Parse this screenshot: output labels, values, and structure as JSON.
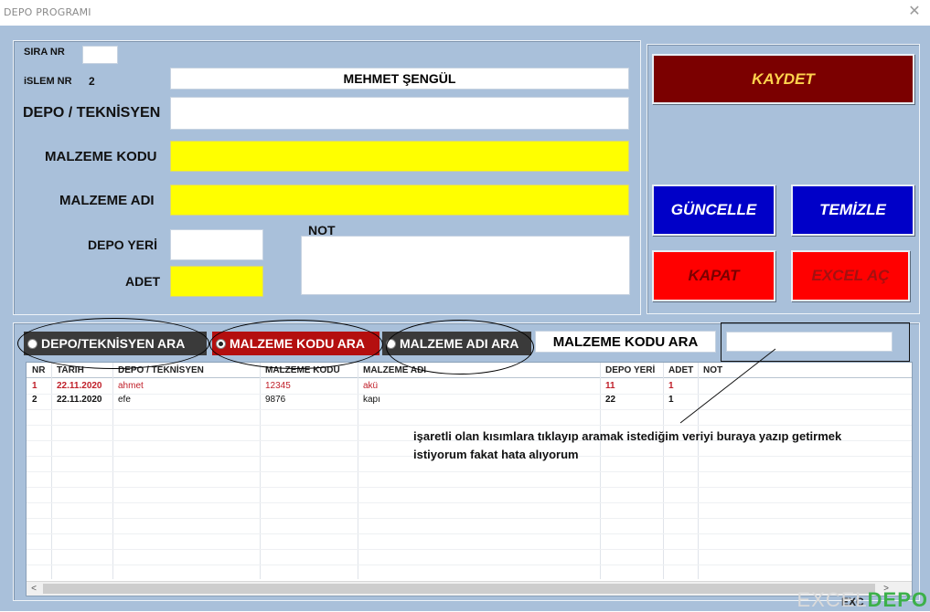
{
  "window": {
    "title": "DEPO PROGRAMI",
    "close_glyph": "✕"
  },
  "form": {
    "sira_nr_label": "SIRA NR",
    "sira_nr_value": "",
    "islem_nr_label": "iSLEM NR",
    "islem_nr_value": "2",
    "user_name": "MEHMET  ŞENGÜL",
    "depo_teknisyen_label": "DEPO / TEKNİSYEN",
    "depo_teknisyen_value": "",
    "malzeme_kodu_label": "MALZEME KODU",
    "malzeme_kodu_value": "",
    "malzeme_adi_label": "MALZEME ADI",
    "malzeme_adi_value": "",
    "depo_yeri_label": "DEPO YERİ",
    "depo_yeri_value": "",
    "adet_label": "ADET",
    "adet_value": "",
    "not_label": "NOT",
    "not_value": ""
  },
  "buttons": {
    "kaydet": "KAYDET",
    "guncelle": "GÜNCELLE",
    "temizle": "TEMİZLE",
    "kapat": "KAPAT",
    "excel_ac": "EXCEL AÇ"
  },
  "search": {
    "option_depo": "DEPO/TEKNİSYEN ARA",
    "option_kodu": "MALZEME KODU ARA",
    "option_adi": "MALZEME ADI ARA",
    "selected": "MALZEME KODU ARA",
    "mode_label": "MALZEME KODU ARA",
    "query_value": ""
  },
  "table": {
    "columns": [
      "NR",
      "TARIH",
      "DEPO / TEKNİSYEN",
      "MALZEME KODU",
      "MALZEME ADI",
      "DEPO YERİ",
      "ADET",
      "NOT"
    ],
    "rows": [
      [
        "1",
        "22.11.2020",
        "ahmet",
        "12345",
        "akü",
        "11",
        "1",
        ""
      ],
      [
        "2",
        "22.11.2020",
        "efe",
        "9876",
        "kapı",
        "22",
        "1",
        ""
      ]
    ],
    "scroll_left_glyph": "<",
    "scroll_right_glyph": ">"
  },
  "annotation": {
    "text": "işaretli olan kısımlara tıklayıp  aramak istediğim veriyi buraya yazıp getirmek istiyorum fakat hata alıyorum"
  },
  "watermark": {
    "part1": "EXCEL",
    "part2": "DEPO",
    "footer_fragment": "EXC"
  },
  "colors": {
    "form_bg": "#a9c0da",
    "kaydet_bg": "#7b0000",
    "kaydet_text": "#ffd34d",
    "blue_btn_bg": "#0000c8",
    "blue_btn_text": "#ffffff",
    "red_btn_bg": "#ff0000",
    "red_btn_text": "#7b0000",
    "excel_text": "#a41010",
    "radio_dark": "#3a3a3a",
    "radio_selected": "#b40f0f",
    "highlight_yellow": "#ffff00",
    "row1_text": "#c0202a"
  }
}
